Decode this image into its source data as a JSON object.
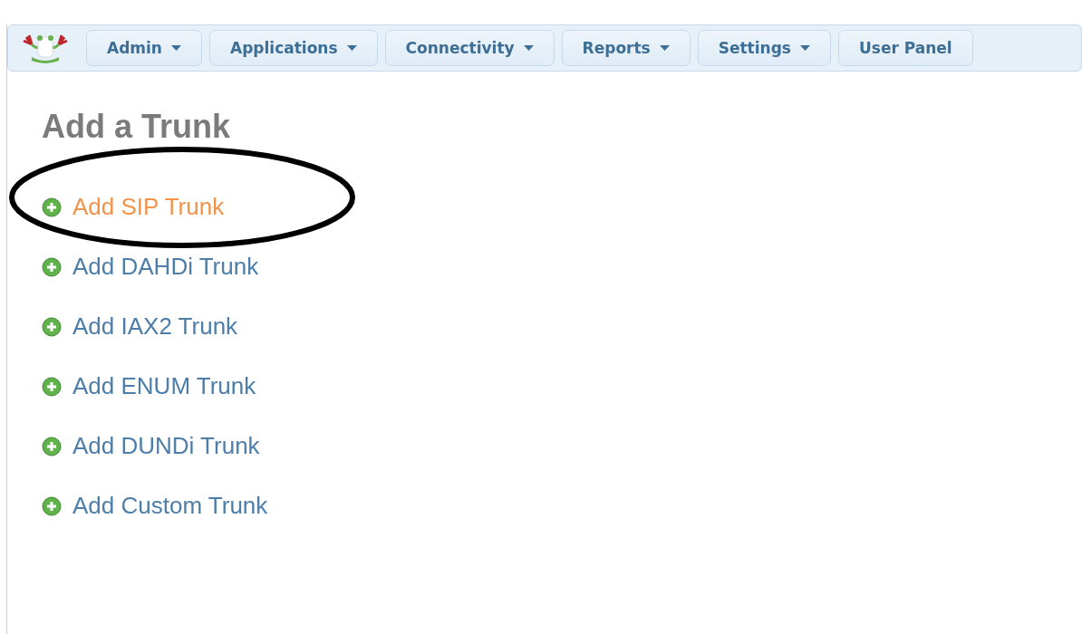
{
  "nav": {
    "items": [
      {
        "label": "Admin",
        "dropdown": true
      },
      {
        "label": "Applications",
        "dropdown": true
      },
      {
        "label": "Connectivity",
        "dropdown": true
      },
      {
        "label": "Reports",
        "dropdown": true
      },
      {
        "label": "Settings",
        "dropdown": true
      },
      {
        "label": "User Panel",
        "dropdown": false
      }
    ]
  },
  "heading": "Add a Trunk",
  "links": [
    {
      "label": "Add SIP Trunk",
      "selected": true
    },
    {
      "label": "Add DAHDi Trunk",
      "selected": false
    },
    {
      "label": "Add IAX2 Trunk",
      "selected": false
    },
    {
      "label": "Add ENUM Trunk",
      "selected": false
    },
    {
      "label": "Add DUNDi Trunk",
      "selected": false
    },
    {
      "label": "Add Custom Trunk",
      "selected": false
    }
  ]
}
